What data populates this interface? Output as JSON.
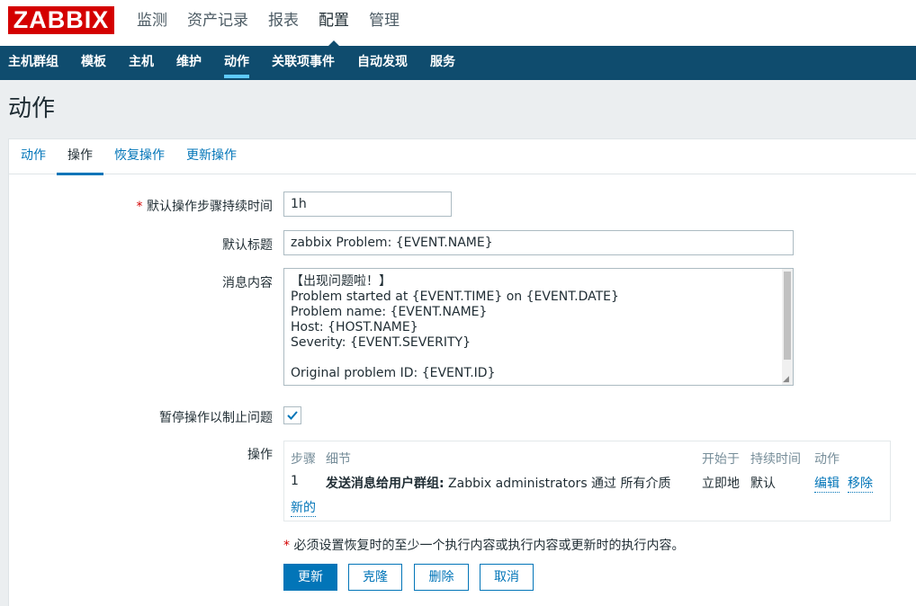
{
  "logo": "ZABBIX",
  "top_menu": [
    {
      "label": "监测"
    },
    {
      "label": "资产记录"
    },
    {
      "label": "报表"
    },
    {
      "label": "配置"
    },
    {
      "label": "管理"
    }
  ],
  "sub_menu": [
    {
      "label": "主机群组"
    },
    {
      "label": "模板"
    },
    {
      "label": "主机"
    },
    {
      "label": "维护"
    },
    {
      "label": "动作"
    },
    {
      "label": "关联项事件"
    },
    {
      "label": "自动发现"
    },
    {
      "label": "服务"
    }
  ],
  "page_title": "动作",
  "tabs": [
    {
      "label": "动作"
    },
    {
      "label": "操作"
    },
    {
      "label": "恢复操作"
    },
    {
      "label": "更新操作"
    }
  ],
  "form": {
    "required_mark": "*",
    "step_duration_label": "默认操作步骤持续时间",
    "step_duration_value": "1h",
    "subject_label": "默认标题",
    "subject_value": "zabbix Problem: {EVENT.NAME}",
    "message_label": "消息内容",
    "message_value": "【出现问题啦！】\nProblem started at {EVENT.TIME} on {EVENT.DATE}\nProblem name: {EVENT.NAME}\nHost: {HOST.NAME}\nSeverity: {EVENT.SEVERITY}\n\nOriginal problem ID: {EVENT.ID}",
    "pause_label": "暂停操作以制止问题",
    "pause_checked": true,
    "operations_label": "操作"
  },
  "operations": {
    "headers": {
      "step": "步骤",
      "details": "细节",
      "start_in": "开始于",
      "duration": "持续时间",
      "action": "动作"
    },
    "rows": [
      {
        "step": "1",
        "details_bold": "发送消息给用户群组:",
        "details_rest": " Zabbix administrators 通过 所有介质",
        "start_in": "立即地",
        "duration": "默认",
        "edit": "编辑",
        "remove": "移除"
      }
    ],
    "new_link": "新的"
  },
  "note": "必须设置恢复时的至少一个执行内容或执行内容或更新时的执行内容。",
  "buttons": {
    "update": "更新",
    "clone": "克隆",
    "delete": "删除",
    "cancel": "取消"
  },
  "colors": {
    "nav_bg": "#0f4c6e",
    "link": "#0275b8",
    "logo_bg": "#d40000",
    "required": "#d40000"
  }
}
